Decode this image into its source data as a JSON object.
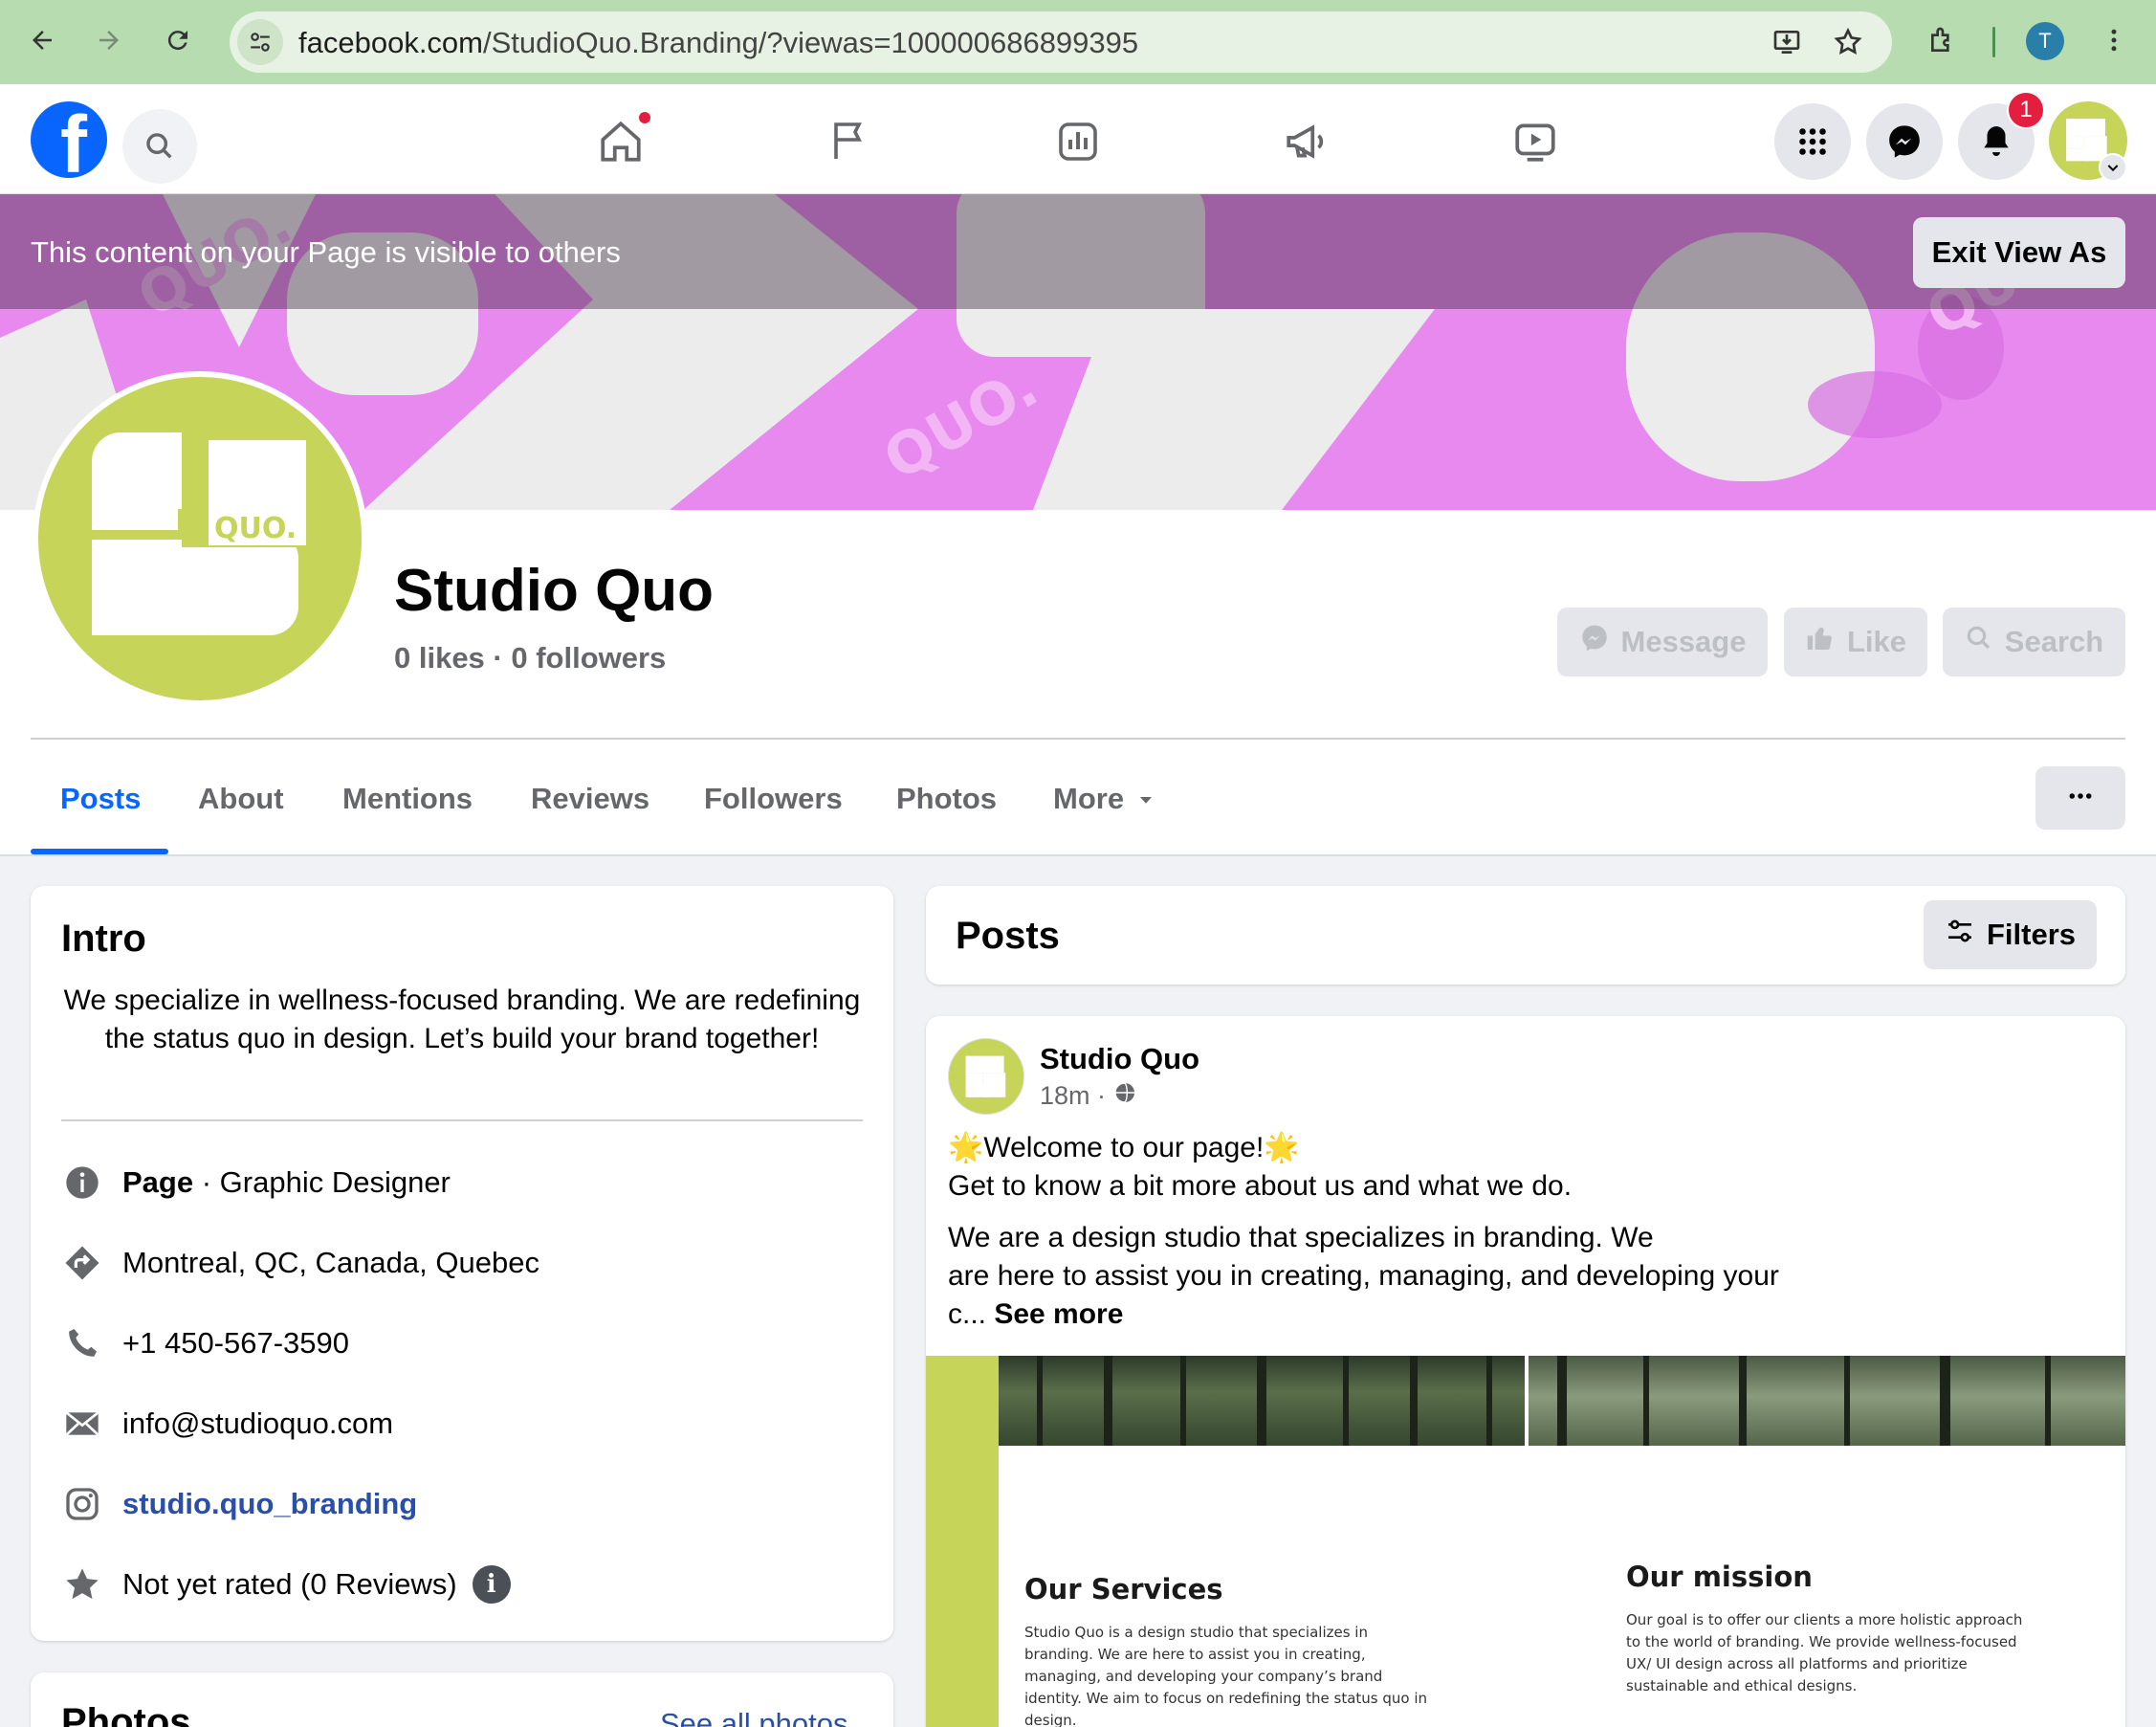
{
  "browser": {
    "url_host": "facebook.com",
    "url_rest": "/StudioQuo.Branding/?viewas=100000686899395",
    "profile_initial": "T"
  },
  "fbnav": {
    "notification_count": "1"
  },
  "viewas": {
    "message": "This content on your Page is visible to others",
    "exit_label": "Exit View As"
  },
  "page": {
    "name": "Studio Quo",
    "likes_line": "0 likes · 0 followers",
    "buttons": {
      "message": "Message",
      "like": "Like",
      "search": "Search"
    },
    "logo_text": "QUO."
  },
  "tabs": [
    "Posts",
    "About",
    "Mentions",
    "Reviews",
    "Followers",
    "Photos",
    "More"
  ],
  "intro": {
    "title": "Intro",
    "bio": "We specialize in wellness-focused branding. We are redefining the status quo in design. Let’s build your brand together!",
    "category_bold": "Page",
    "category_rest": " · Graphic Designer",
    "location": "Montreal, QC, Canada, Quebec",
    "phone": "+1 450-567-3590",
    "email": "info@studioquo.com",
    "instagram": "studio.quo_branding",
    "rating": "Not yet rated (0 Reviews)"
  },
  "photos_section": {
    "title": "Photos",
    "see_all": "See all photos"
  },
  "posts_section": {
    "title": "Posts",
    "filters_label": "Filters"
  },
  "post": {
    "author": "Studio Quo",
    "time": "18m ·",
    "line1": "🌟Welcome to our page!🌟",
    "line2": "Get to know a bit more about us and what we do.",
    "body_a": "We are a design studio that specializes in branding. We",
    "body_b": "are here to assist you in creating, managing, and developing your",
    "body_c": "c... ",
    "see_more": "See more",
    "image": {
      "services_title": "Our Services",
      "services_body": "Studio Quo is a design studio that specializes in branding. We are here to assist you in creating, managing, and developing your company’s brand identity. We aim to focus on redefining the status quo in design.",
      "mission_title": "Our mission",
      "mission_body": "Our goal is to offer our clients a more holistic approach to the world of branding. We provide wellness-focused UX/ UI design across all platforms and prioritize sustainable and ethical designs."
    }
  },
  "colors": {
    "fb_blue": "#0866ff",
    "brand_lime": "#c6d45a",
    "cover_pink": "#e789ee",
    "link_blue": "#2a4fa8"
  }
}
